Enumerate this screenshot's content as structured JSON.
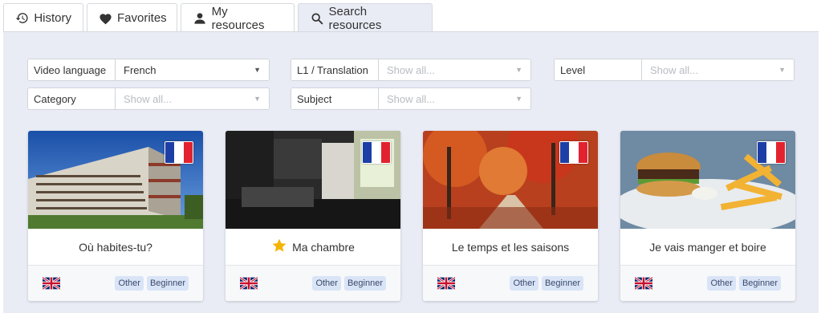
{
  "tabs": [
    {
      "label": "History",
      "icon": "history-icon"
    },
    {
      "label": "Favorites",
      "icon": "heart-icon"
    },
    {
      "label": "My resources",
      "icon": "user-icon"
    },
    {
      "label": "Search resources",
      "icon": "search-icon",
      "active": true
    }
  ],
  "filters": {
    "video_language": {
      "label": "Video language",
      "value": "French"
    },
    "translation": {
      "label": "L1 / Translation",
      "placeholder": "Show all..."
    },
    "level": {
      "label": "Level",
      "placeholder": "Show all..."
    },
    "category": {
      "label": "Category",
      "placeholder": "Show all..."
    },
    "subject": {
      "label": "Subject",
      "placeholder": "Show all..."
    }
  },
  "cards": [
    {
      "title": "Où habites-tu?",
      "favorite": false,
      "tags": [
        "Other",
        "Beginner"
      ],
      "language_flag": "fr",
      "translation_flag": "uk"
    },
    {
      "title": "Ma chambre",
      "favorite": true,
      "tags": [
        "Other",
        "Beginner"
      ],
      "language_flag": "fr",
      "translation_flag": "uk"
    },
    {
      "title": "Le temps et les saisons",
      "favorite": false,
      "tags": [
        "Other",
        "Beginner"
      ],
      "language_flag": "fr",
      "translation_flag": "uk"
    },
    {
      "title": "Je vais manger et boire",
      "favorite": false,
      "tags": [
        "Other",
        "Beginner"
      ],
      "language_flag": "fr",
      "translation_flag": "uk"
    }
  ],
  "colors": {
    "panel_bg": "#e9ecf5",
    "badge_bg": "#d9e4f7",
    "star": "#f5b400",
    "flag_blue": "#1d3fa5",
    "flag_red": "#e2232f"
  }
}
